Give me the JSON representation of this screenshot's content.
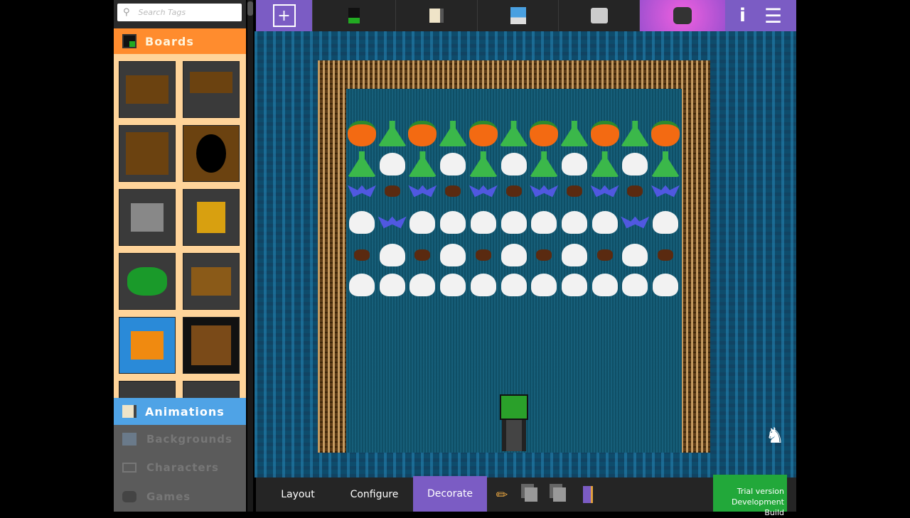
{
  "sidebar": {
    "search_placeholder": "Search Tags",
    "boards_label": "Boards",
    "animations_label": "Animations",
    "categories": [
      {
        "label": "Backgrounds",
        "icon": "background-icon"
      },
      {
        "label": "Characters",
        "icon": "robot-icon"
      },
      {
        "label": "Games",
        "icon": "gamepad-icon"
      }
    ],
    "colors": {
      "boards": "#ff8c2e",
      "animations": "#4fa3e6"
    }
  },
  "toolbar": {
    "tabs": [
      "add",
      "boards",
      "animations",
      "backgrounds",
      "characters",
      "games",
      "info",
      "menu"
    ],
    "active": "games"
  },
  "bottom": {
    "layout": "Layout",
    "configure": "Configure",
    "decorate": "Decorate",
    "active": "Decorate"
  },
  "build": {
    "line1": "Trial version",
    "line2": "Development Build"
  },
  "board": {
    "rows": [
      [
        "pumpkin",
        "potion",
        "pumpkin",
        "potion",
        "pumpkin",
        "potion",
        "pumpkin",
        "potion",
        "pumpkin",
        "potion",
        "pumpkin"
      ],
      [
        "potion",
        "skull",
        "potion",
        "skull",
        "potion",
        "skull",
        "potion",
        "skull",
        "potion",
        "skull",
        "potion"
      ],
      [
        "bat",
        "spider",
        "bat",
        "spider",
        "bat",
        "spider",
        "bat",
        "spider",
        "bat",
        "spider",
        "bat"
      ],
      [
        "skull",
        "bat",
        "skull",
        "skull",
        "skull",
        "skull",
        "skull",
        "skull",
        "skull",
        "bat",
        "skull"
      ],
      [
        "spider",
        "skull",
        "spider",
        "skull",
        "spider",
        "skull",
        "spider",
        "skull",
        "spider",
        "skull",
        "spider"
      ],
      [
        "skull",
        "skull",
        "skull",
        "skull",
        "skull",
        "skull",
        "skull",
        "skull",
        "skull",
        "skull",
        "skull"
      ]
    ]
  }
}
